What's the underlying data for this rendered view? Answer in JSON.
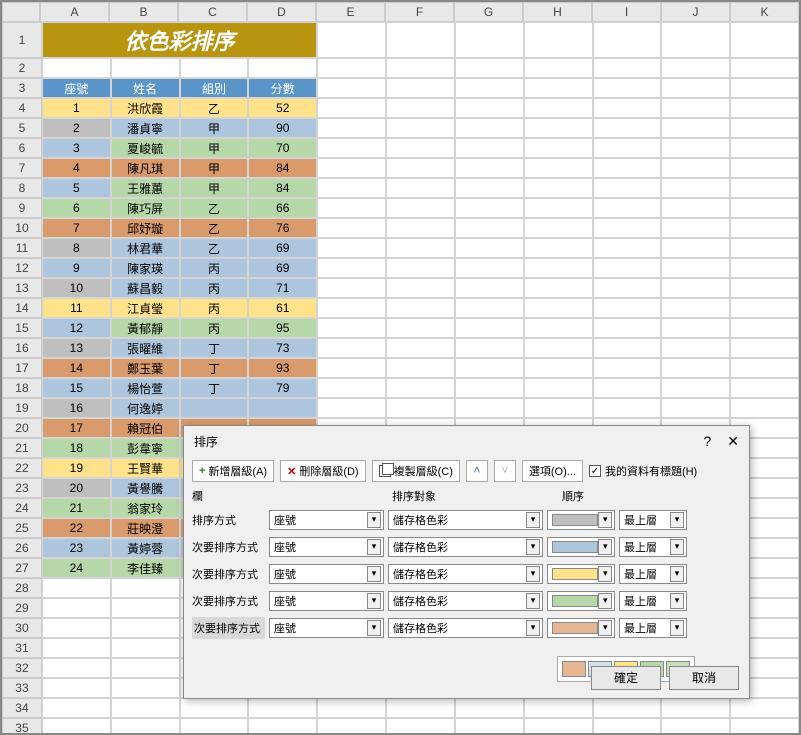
{
  "columns": [
    "A",
    "B",
    "C",
    "D",
    "E",
    "F",
    "G",
    "H",
    "I",
    "J",
    "K"
  ],
  "title": "依色彩排序",
  "headers": [
    "座號",
    "姓名",
    "組別",
    "分數"
  ],
  "rows": [
    {
      "n": 1,
      "name": "洪欣霞",
      "grp": "乙",
      "score": 52,
      "bg": "bg-yellow",
      "nbg": "bg-yellow"
    },
    {
      "n": 2,
      "name": "潘貞寧",
      "grp": "甲",
      "score": 90,
      "bg": "bg-blue",
      "nbg": "bg-gray"
    },
    {
      "n": 3,
      "name": "夏峻毓",
      "grp": "甲",
      "score": 70,
      "bg": "bg-green",
      "nbg": "bg-blue"
    },
    {
      "n": 4,
      "name": "陳凡琪",
      "grp": "甲",
      "score": 84,
      "bg": "bg-orange",
      "nbg": "bg-orange"
    },
    {
      "n": 5,
      "name": "王雅蕙",
      "grp": "甲",
      "score": 84,
      "bg": "bg-green",
      "nbg": "bg-blue"
    },
    {
      "n": 6,
      "name": "陳巧屏",
      "grp": "乙",
      "score": 66,
      "bg": "bg-green",
      "nbg": "bg-green"
    },
    {
      "n": 7,
      "name": "邱妤璇",
      "grp": "乙",
      "score": 76,
      "bg": "bg-orange",
      "nbg": "bg-orange"
    },
    {
      "n": 8,
      "name": "林君華",
      "grp": "乙",
      "score": 69,
      "bg": "bg-blue",
      "nbg": "bg-gray"
    },
    {
      "n": 9,
      "name": "陳家瑛",
      "grp": "丙",
      "score": 69,
      "bg": "bg-blue",
      "nbg": "bg-blue"
    },
    {
      "n": 10,
      "name": "蘇昌毅",
      "grp": "丙",
      "score": 71,
      "bg": "bg-blue",
      "nbg": "bg-gray"
    },
    {
      "n": 11,
      "name": "江貞瑩",
      "grp": "丙",
      "score": 61,
      "bg": "bg-yellow",
      "nbg": "bg-yellow"
    },
    {
      "n": 12,
      "name": "黃郁靜",
      "grp": "丙",
      "score": 95,
      "bg": "bg-green",
      "nbg": "bg-blue"
    },
    {
      "n": 13,
      "name": "張曜維",
      "grp": "丁",
      "score": 73,
      "bg": "bg-blue",
      "nbg": "bg-gray"
    },
    {
      "n": 14,
      "name": "鄭玉葉",
      "grp": "丁",
      "score": 93,
      "bg": "bg-orange",
      "nbg": "bg-orange"
    },
    {
      "n": 15,
      "name": "楊怡萱",
      "grp": "丁",
      "score": 79,
      "bg": "bg-blue",
      "nbg": "bg-blue"
    },
    {
      "n": 16,
      "name": "何逸婷",
      "grp": "",
      "score": "",
      "bg": "bg-blue",
      "nbg": "bg-gray"
    },
    {
      "n": 17,
      "name": "賴冠伯",
      "grp": "",
      "score": "",
      "bg": "bg-orange",
      "nbg": "bg-orange"
    },
    {
      "n": 18,
      "name": "彭韋寧",
      "grp": "",
      "score": "",
      "bg": "bg-green",
      "nbg": "bg-green"
    },
    {
      "n": 19,
      "name": "王賢華",
      "grp": "",
      "score": "",
      "bg": "bg-yellow",
      "nbg": "bg-yellow"
    },
    {
      "n": 20,
      "name": "黃譽騰",
      "grp": "",
      "score": "",
      "bg": "bg-blue",
      "nbg": "bg-gray"
    },
    {
      "n": 21,
      "name": "翁家玲",
      "grp": "",
      "score": "",
      "bg": "bg-green",
      "nbg": "bg-green"
    },
    {
      "n": 22,
      "name": "莊映澄",
      "grp": "",
      "score": "",
      "bg": "bg-orange",
      "nbg": "bg-orange"
    },
    {
      "n": 23,
      "name": "黃婷蓉",
      "grp": "",
      "score": "",
      "bg": "bg-blue",
      "nbg": "bg-blue"
    },
    {
      "n": 24,
      "name": "李佳臻",
      "grp": "",
      "score": "",
      "bg": "bg-green",
      "nbg": "bg-green"
    }
  ],
  "dialog": {
    "title": "排序",
    "add": "新增層級(A)",
    "del": "刪除層級(D)",
    "copy": "複製層級(C)",
    "options": "選項(O)...",
    "hasHeader": "我的資料有標題(H)",
    "colHeaders": {
      "col": "欄",
      "target": "排序對象",
      "order": "順序"
    },
    "levels": [
      {
        "label": "排序方式",
        "field": "座號",
        "target": "儲存格色彩",
        "sw": "sw-gray",
        "pos": "最上層"
      },
      {
        "label": "次要排序方式",
        "field": "座號",
        "target": "儲存格色彩",
        "sw": "sw-blue",
        "pos": "最上層"
      },
      {
        "label": "次要排序方式",
        "field": "座號",
        "target": "儲存格色彩",
        "sw": "sw-yellow",
        "pos": "最上層"
      },
      {
        "label": "次要排序方式",
        "field": "座號",
        "target": "儲存格色彩",
        "sw": "sw-green",
        "pos": "最上層"
      },
      {
        "label": "次要排序方式",
        "field": "座號",
        "target": "儲存格色彩",
        "sw": "sw-orange",
        "pos": "最上層"
      }
    ],
    "palette": [
      "sw-orange",
      "sw-blue",
      "sw-yellow",
      "sw-green",
      "sw-green"
    ],
    "ok": "確定",
    "cancel": "取消"
  }
}
